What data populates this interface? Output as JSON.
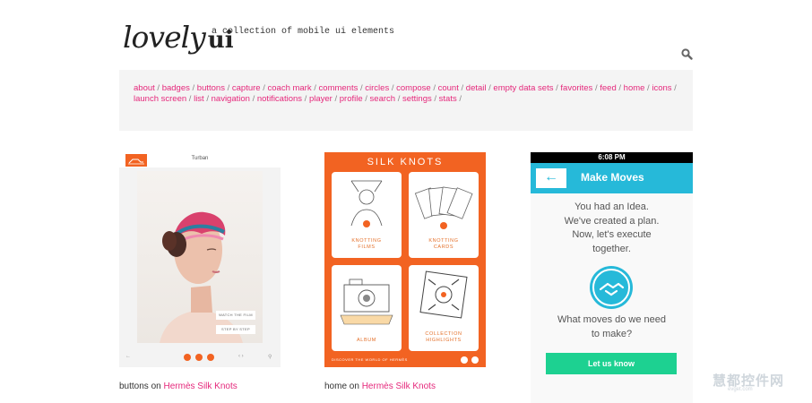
{
  "header": {
    "logo_script": "lovely",
    "logo_ui": "ui",
    "tagline": "a collection of mobile ui elements"
  },
  "nav": {
    "row1": [
      "about",
      "badges",
      "buttons",
      "capture",
      "coach mark",
      "comments",
      "circles",
      "compose",
      "count",
      "detail",
      "empty data sets",
      "favorites",
      "feed",
      "home",
      "icons"
    ],
    "row2": [
      "launch screen",
      "list",
      "navigation",
      "notifications",
      "player",
      "profile",
      "search",
      "settings",
      "stats"
    ]
  },
  "cards": [
    {
      "kind": "buttons",
      "caption_prefix": "buttons on",
      "caption_link": "Hermès Silk Knots",
      "title": "Turban",
      "watch_label": "WATCH THE FILM",
      "step_label": "STEP BY STEP"
    },
    {
      "kind": "home",
      "caption_prefix": "home on",
      "caption_link": "Hermès Silk Knots",
      "title": "SILK KNOTS",
      "tiles": [
        "KNOTTING\nFILMS",
        "KNOTTING\nCARDS",
        "ALBUM",
        "COLLECTION\nHIGHLIGHTS"
      ],
      "footer": "DISCOVER THE WORLD OF HERMÈS"
    },
    {
      "kind": "onboarding",
      "time": "6:08 PM",
      "title": "Make Moves",
      "intro_lines": [
        "You had an Idea.",
        "We've created a plan.",
        "Now, let's execute",
        "together."
      ],
      "question_lines": [
        "What moves do we need",
        "to make?"
      ],
      "cta": "Let us know"
    }
  ],
  "watermark": {
    "line1": "慧都控件网",
    "line2": "evget.com"
  },
  "colors": {
    "link_pink": "#e5287b",
    "hermes_orange": "#f26322",
    "teal": "#26b9d9",
    "cta_green": "#1dd191"
  },
  "icons": [
    "search-icon",
    "back-arrow-icon",
    "handshake-icon",
    "heart-icon",
    "share-icon",
    "info-icon"
  ]
}
